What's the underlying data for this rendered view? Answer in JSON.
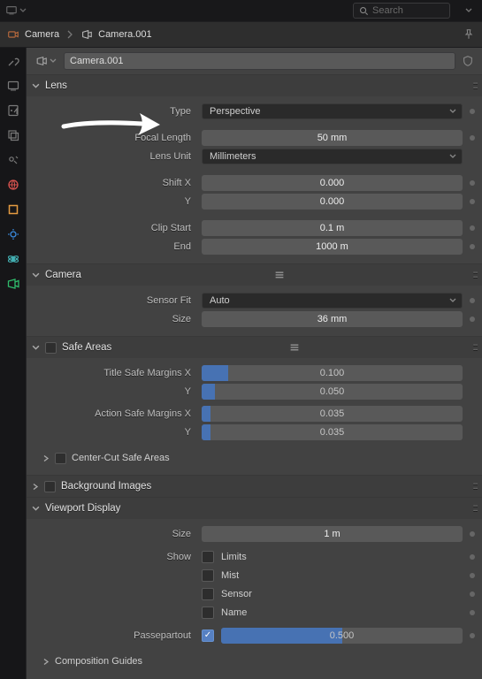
{
  "header": {
    "search_placeholder": "Search"
  },
  "breadcrumb": {
    "object": "Camera",
    "data": "Camera.001"
  },
  "datablock": {
    "name": "Camera.001"
  },
  "lens": {
    "title": "Lens",
    "type_label": "Type",
    "type_value": "Perspective",
    "focal_label": "Focal Length",
    "focal_value": "50 mm",
    "unit_label": "Lens Unit",
    "unit_value": "Millimeters",
    "shiftx_label": "Shift X",
    "shiftx_value": "0.000",
    "shifty_label": "Y",
    "shifty_value": "0.000",
    "clipstart_label": "Clip Start",
    "clipstart_value": "0.1 m",
    "clipend_label": "End",
    "clipend_value": "1000 m"
  },
  "camera": {
    "title": "Camera",
    "fit_label": "Sensor Fit",
    "fit_value": "Auto",
    "size_label": "Size",
    "size_value": "36 mm"
  },
  "safe": {
    "title": "Safe Areas",
    "title_x_label": "Title Safe Margins X",
    "title_x_value": "0.100",
    "title_y_label": "Y",
    "title_y_value": "0.050",
    "action_x_label": "Action Safe Margins X",
    "action_x_value": "0.035",
    "action_y_label": "Y",
    "action_y_value": "0.035",
    "center_cut": "Center-Cut Safe Areas"
  },
  "bg": {
    "title": "Background Images"
  },
  "viewport": {
    "title": "Viewport Display",
    "size_label": "Size",
    "size_value": "1 m",
    "show_label": "Show",
    "show_limits": "Limits",
    "show_mist": "Mist",
    "show_sensor": "Sensor",
    "show_name": "Name",
    "passepartout_label": "Passepartout",
    "passepartout_value": "0.500",
    "composition": "Composition Guides"
  }
}
